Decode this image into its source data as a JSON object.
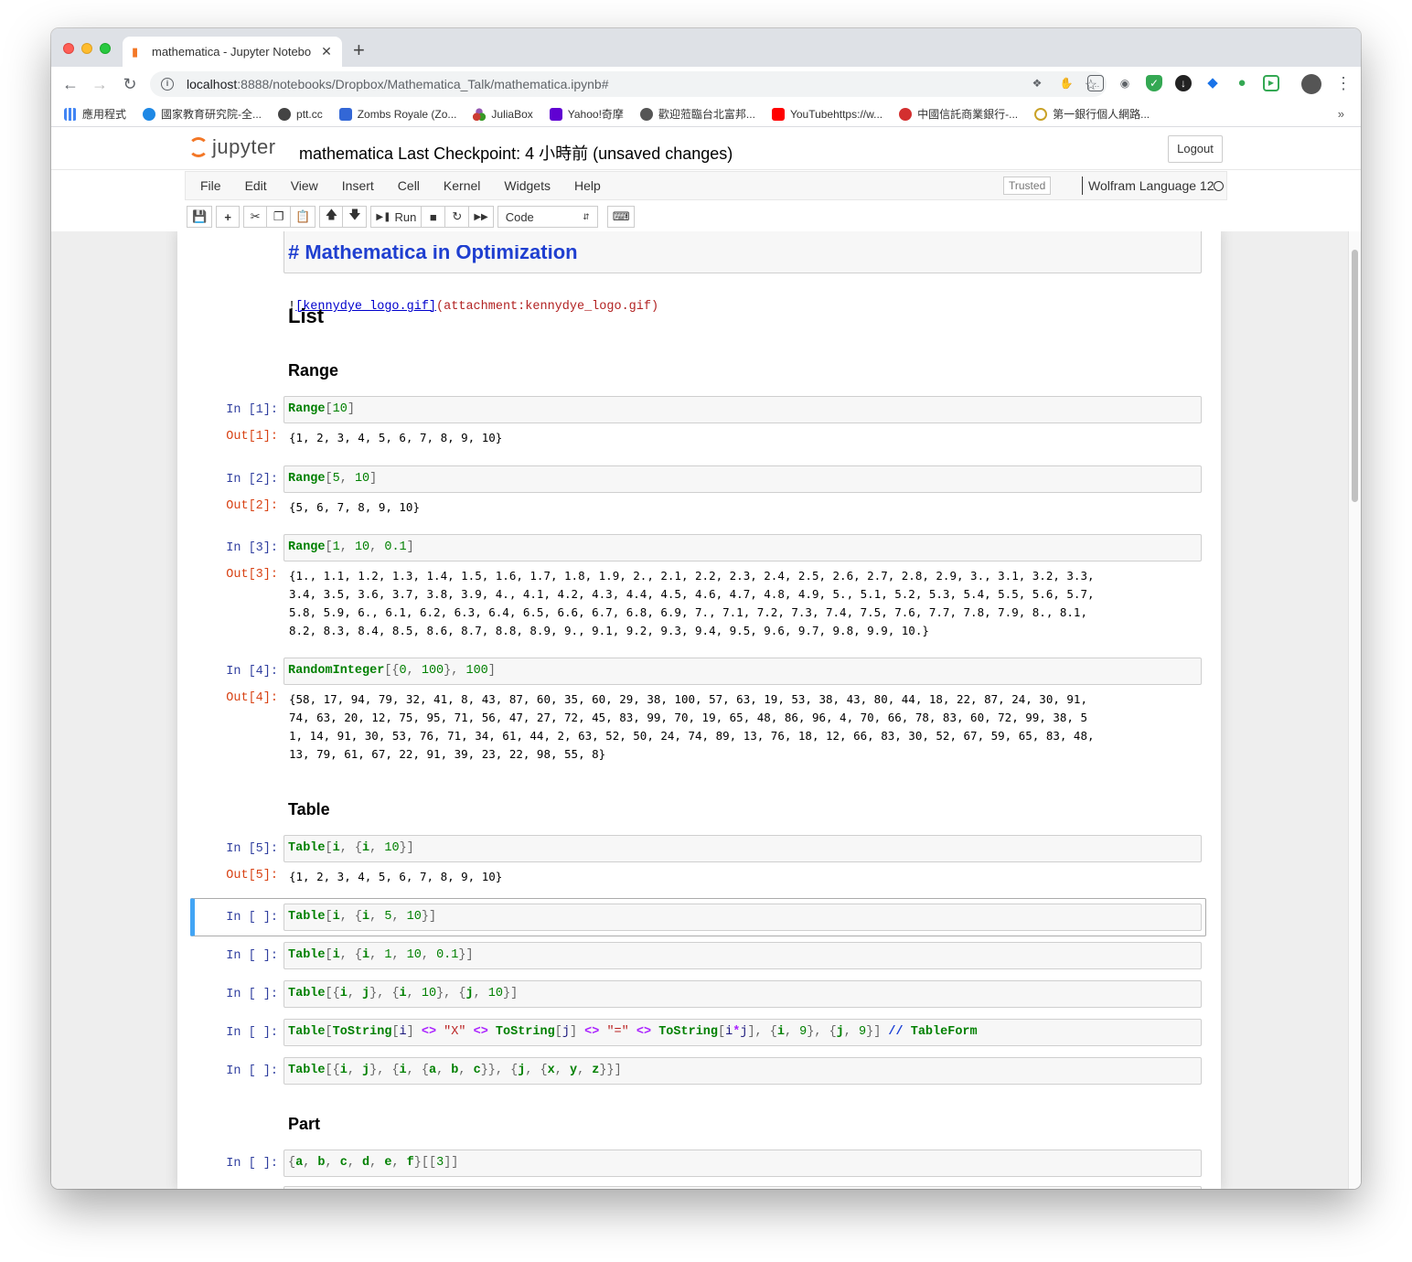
{
  "browser": {
    "tab_title": "mathematica - Jupyter Notebo",
    "url_host": "localhost",
    "url_path": ":8888/notebooks/Dropbox/Mathematica_Talk/mathematica.ipynb#",
    "bookmarks": [
      {
        "label": "應用程式",
        "icon": "apps-grid-icon",
        "color": "#4285f4"
      },
      {
        "label": "國家教育研究院-全...",
        "icon": "people-icon",
        "color": "#1e88e5"
      },
      {
        "label": "ptt.cc",
        "icon": "p-circle-icon",
        "color": "#444444"
      },
      {
        "label": "Zombs Royale (Zo...",
        "icon": "zombs-icon",
        "color": "#3367d6"
      },
      {
        "label": "JuliaBox",
        "icon": "julia-dots-icon",
        "color": "#9558b2"
      },
      {
        "label": "Yahoo!奇摩",
        "icon": "yahoo-icon",
        "color": "#6001d2"
      },
      {
        "label": "歡迎蒞臨台北富邦...",
        "icon": "fubon-icon",
        "color": "#555555"
      },
      {
        "label": "YouTubehttps://w...",
        "icon": "youtube-icon",
        "color": "#ff0000"
      },
      {
        "label": "中國信託商業銀行-...",
        "icon": "ctbc-icon",
        "color": "#d32f2f"
      },
      {
        "label": "第一銀行個人網路...",
        "icon": "firstbank-icon",
        "color": "#c9a227"
      }
    ],
    "bookmarks_more": "»"
  },
  "jupyter": {
    "logo_text": "jupyter",
    "notebook_name": "mathematica",
    "checkpoint": "Last Checkpoint: 4 小時前  (unsaved changes)",
    "logout": "Logout",
    "menu": [
      "File",
      "Edit",
      "View",
      "Insert",
      "Cell",
      "Kernel",
      "Widgets",
      "Help"
    ],
    "trusted": "Trusted",
    "kernel": "Wolfram Language 12",
    "run_label": "Run",
    "cell_type": "Code"
  },
  "cells": {
    "heading_partial": "# Mathematica in Optimization",
    "attach_bang": "!",
    "attach_link": "[kennydye_logo.gif]",
    "attach_target": "(attachment:kennydye_logo.gif)",
    "h_list": "List",
    "h_range": "Range",
    "h_table": "Table",
    "h_part": "Part",
    "in1": "In [1]:",
    "out1": "Out[1]:",
    "out1_text": "{1, 2, 3, 4, 5, 6, 7, 8, 9, 10}",
    "in2": "In [2]:",
    "out2": "Out[2]:",
    "out2_text": "{5, 6, 7, 8, 9, 10}",
    "in3": "In [3]:",
    "out3": "Out[3]:",
    "out3_text": "{1., 1.1, 1.2, 1.3, 1.4, 1.5, 1.6, 1.7, 1.8, 1.9, 2., 2.1, 2.2, 2.3, 2.4, 2.5, 2.6, 2.7, 2.8, 2.9, 3., 3.1, 3.2, 3.3,\n3.4, 3.5, 3.6, 3.7, 3.8, 3.9, 4., 4.1, 4.2, 4.3, 4.4, 4.5, 4.6, 4.7, 4.8, 4.9, 5., 5.1, 5.2, 5.3, 5.4, 5.5, 5.6, 5.7,\n5.8, 5.9, 6., 6.1, 6.2, 6.3, 6.4, 6.5, 6.6, 6.7, 6.8, 6.9, 7., 7.1, 7.2, 7.3, 7.4, 7.5, 7.6, 7.7, 7.8, 7.9, 8., 8.1,\n8.2, 8.3, 8.4, 8.5, 8.6, 8.7, 8.8, 8.9, 9., 9.1, 9.2, 9.3, 9.4, 9.5, 9.6, 9.7, 9.8, 9.9, 10.}",
    "in4": "In [4]:",
    "out4": "Out[4]:",
    "out4_text": "{58, 17, 94, 79, 32, 41, 8, 43, 87, 60, 35, 60, 29, 38, 100, 57, 63, 19, 53, 38, 43, 80, 44, 18, 22, 87, 24, 30, 91,\n74, 63, 20, 12, 75, 95, 71, 56, 47, 27, 72, 45, 83, 99, 70, 19, 65, 48, 86, 96, 4, 70, 66, 78, 83, 60, 72, 99, 38, 5\n1, 14, 91, 30, 53, 76, 71, 34, 61, 44, 2, 63, 52, 50, 24, 74, 89, 13, 76, 18, 12, 66, 83, 30, 52, 67, 59, 65, 83, 48,\n13, 79, 61, 67, 22, 91, 39, 23, 22, 98, 55, 8}",
    "in5": "In [5]:",
    "out5": "Out[5]:",
    "out5_text": "{1, 2, 3, 4, 5, 6, 7, 8, 9, 10}",
    "in_empty": "In [ ]:"
  }
}
